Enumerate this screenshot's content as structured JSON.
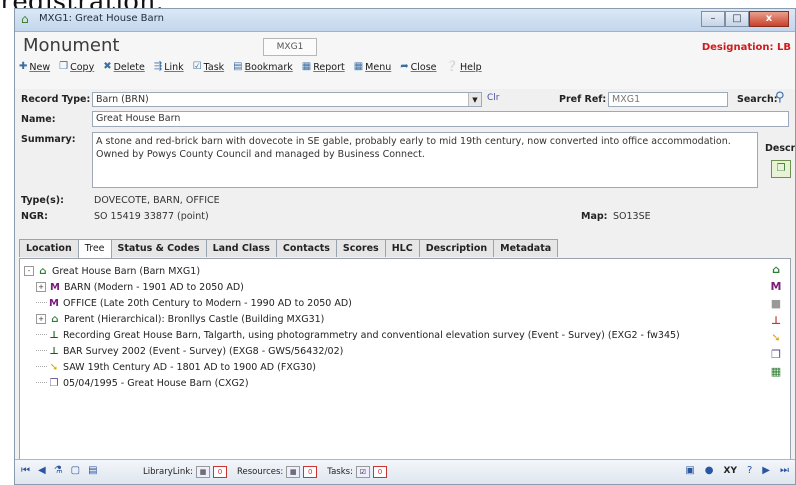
{
  "caption": "registration.",
  "window": {
    "title": "MXG1: Great House Barn",
    "minimize": "–",
    "maximize": "□",
    "close": "x"
  },
  "header": {
    "form_title": "Monument",
    "record_id": "MXG1",
    "designation": "Designation: LB"
  },
  "toolbar": [
    {
      "name": "new",
      "icon": "new-icon",
      "glyph": "✚",
      "label": "New"
    },
    {
      "name": "copy",
      "icon": "copy-icon",
      "glyph": "❐",
      "label": "Copy"
    },
    {
      "name": "delete",
      "icon": "delete-icon",
      "glyph": "✖",
      "label": "Delete"
    },
    {
      "name": "link",
      "icon": "link-icon",
      "glyph": "⇶",
      "label": "Link"
    },
    {
      "name": "task",
      "icon": "task-icon",
      "glyph": "☑",
      "label": "Task"
    },
    {
      "name": "bookmark",
      "icon": "bookmark-icon",
      "glyph": "▤",
      "label": "Bookmark"
    },
    {
      "name": "report",
      "icon": "report-icon",
      "glyph": "▦",
      "label": "Report"
    },
    {
      "name": "menu",
      "icon": "menu-icon",
      "glyph": "▦",
      "label": "Menu"
    },
    {
      "name": "close",
      "icon": "close-icon",
      "glyph": "➦",
      "label": "Close"
    },
    {
      "name": "help",
      "icon": "help-icon",
      "glyph": "❔",
      "label": "Help"
    }
  ],
  "form": {
    "record_type_label": "Record Type:",
    "record_type_value": "Barn (BRN)",
    "clr_label": "Clr",
    "pref_ref_label": "Pref Ref:",
    "pref_ref_value": "MXG1",
    "search_label": "Search:",
    "name_label": "Name:",
    "name_value": "Great House Barn",
    "summary_label": "Summary:",
    "summary_value": "A stone and red-brick barn with dovecote in SE gable, probably early to mid 19th century, now converted into office accommodation. Owned by Powys County Council and managed by Business Connect.",
    "desc_label": "Descr",
    "types_label": "Type(s):",
    "types_value": "DOVECOTE, BARN, OFFICE",
    "ngr_label": "NGR:",
    "ngr_value": "SO 15419 33877 (point)",
    "map_label": "Map:",
    "map_value": "SO13SE"
  },
  "tabs": [
    "Location",
    "Tree",
    "Status & Codes",
    "Land Class",
    "Contacts",
    "Scores",
    "HLC",
    "Description",
    "Metadata"
  ],
  "tree": [
    {
      "label": "Great House Barn (Barn MXG1)",
      "glyph": "⌂",
      "color": "#2e7d32",
      "exp": "-",
      "indent": 0,
      "icon": "building-icon"
    },
    {
      "label": "BARN (Modern - 1901 AD to 2050 AD)",
      "glyph": "M",
      "color": "#7a1a7a",
      "exp": "+",
      "indent": 1,
      "icon": "monument-type-icon"
    },
    {
      "label": "OFFICE (Late 20th Century to Modern - 1990 AD to 2050 AD)",
      "glyph": "M",
      "color": "#7a1a7a",
      "exp": "",
      "indent": 1,
      "icon": "monument-type-icon"
    },
    {
      "label": "Parent (Hierarchical): Bronllys Castle (Building MXG31)",
      "glyph": "⌂",
      "color": "#2e7d32",
      "exp": "+",
      "indent": 1,
      "icon": "parent-building-icon"
    },
    {
      "label": "Recording Great House Barn, Talgarth, using photogrammetry and conventional elevation survey (Event - Survey) (EXG2 - fw345)",
      "glyph": "⊥",
      "color": "#1a5d1a",
      "exp": "",
      "indent": 1,
      "icon": "survey-event-icon"
    },
    {
      "label": "BAR Survey 2002 (Event - Survey) (EXG8 - GWS/56432/02)",
      "glyph": "⊥",
      "color": "#1a5d1a",
      "exp": "",
      "indent": 1,
      "icon": "survey-event-icon"
    },
    {
      "label": "SAW 19th Century AD - 1801 AD to 1900 AD (FXG30)",
      "glyph": "➘",
      "color": "#d6a400",
      "exp": "",
      "indent": 1,
      "icon": "find-icon"
    },
    {
      "label": "05/04/1995 - Great House Barn (CXG2)",
      "glyph": "❐",
      "color": "#5a4a8a",
      "exp": "",
      "indent": 1,
      "icon": "source-icon"
    }
  ],
  "side_icons": [
    {
      "icon": "building-icon",
      "glyph": "⌂",
      "color": "#2e7d32"
    },
    {
      "icon": "monument-type-icon",
      "glyph": "M",
      "color": "#7a1a7a"
    },
    {
      "icon": "grey-box-icon",
      "glyph": "■",
      "color": "#999999"
    },
    {
      "icon": "survey-event-icon",
      "glyph": "⊥",
      "color": "#c0392b"
    },
    {
      "icon": "find-icon",
      "glyph": "➘",
      "color": "#d6a400"
    },
    {
      "icon": "source-icon",
      "glyph": "❐",
      "color": "#5a4a8a"
    },
    {
      "icon": "archive-icon",
      "glyph": "▦",
      "color": "#2e7d32"
    }
  ],
  "statusbar": {
    "library_label": "LibraryLink:",
    "library_count": "0",
    "resources_label": "Resources:",
    "resources_count": "0",
    "tasks_label": "Tasks:",
    "tasks_count": "0",
    "xy_label": "XY"
  }
}
